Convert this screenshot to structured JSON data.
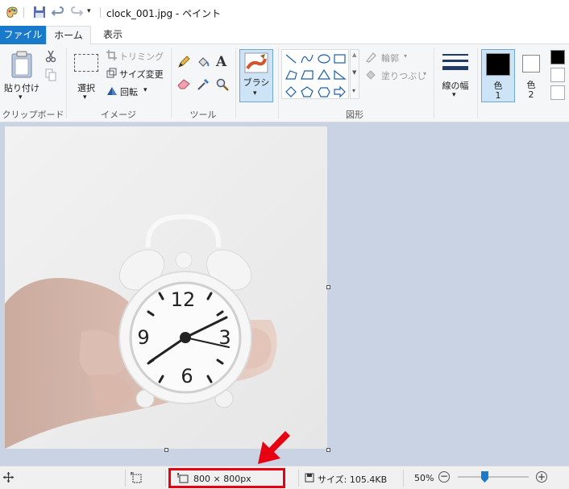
{
  "window": {
    "title": "clock_001.jpg - ペイント"
  },
  "tabs": {
    "file": "ファイル",
    "home": "ホーム",
    "view": "表示"
  },
  "clipboard": {
    "paste_label": "貼り付け",
    "group_label": "クリップボード"
  },
  "image": {
    "select_label": "選択",
    "crop_label": "トリミング",
    "resize_label": "サイズ変更",
    "rotate_label": "回転",
    "group_label": "イメージ"
  },
  "tools": {
    "group_label": "ツール"
  },
  "brushes": {
    "label": "ブラシ"
  },
  "shapes": {
    "outline_label": "輪郭",
    "fill_label": "塗りつぶし",
    "group_label": "図形"
  },
  "size": {
    "label": "線の幅"
  },
  "colors": {
    "color1_label": "色",
    "color1_num": "1",
    "color2_label": "色",
    "color2_num": "2",
    "color1_value": "#000000",
    "color2_value": "#ffffff"
  },
  "status": {
    "dimensions": "800 × 800px",
    "filesize": "サイズ: 105.4KB",
    "zoom": "50%",
    "zoom_level": 0.38
  },
  "annotation": {
    "arrow_color": "#e60012"
  }
}
